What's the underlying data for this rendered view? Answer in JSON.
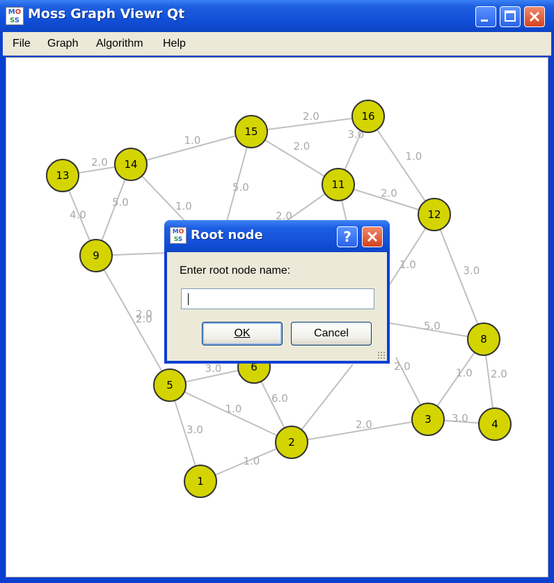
{
  "window": {
    "title": "Moss Graph Viewr Qt",
    "icon": "moss-app-icon"
  },
  "menu": [
    "File",
    "Graph",
    "Algorithm",
    "Help"
  ],
  "graph": {
    "nodes": [
      {
        "id": "1"
      },
      {
        "id": "2"
      },
      {
        "id": "3"
      },
      {
        "id": "4"
      },
      {
        "id": "5"
      },
      {
        "id": "6"
      },
      {
        "id": "8"
      },
      {
        "id": "9"
      },
      {
        "id": "11"
      },
      {
        "id": "12"
      },
      {
        "id": "13"
      },
      {
        "id": "14"
      },
      {
        "id": "15"
      },
      {
        "id": "16"
      }
    ],
    "edges": [
      {
        "from": "13",
        "to": "14",
        "weight": "2.0"
      },
      {
        "from": "14",
        "to": "15",
        "weight": "1.0"
      },
      {
        "from": "15",
        "to": "16",
        "weight": "2.0"
      },
      {
        "from": "15",
        "to": "11",
        "weight": "2.0"
      },
      {
        "from": "16",
        "to": "11",
        "weight": "3.0"
      },
      {
        "from": "16",
        "to": "12",
        "weight": "1.0"
      },
      {
        "from": "11",
        "to": "12",
        "weight": "2.0"
      },
      {
        "from": "13",
        "to": "9",
        "weight": "4.0"
      },
      {
        "from": "14",
        "to": "9",
        "weight": "5.0"
      },
      {
        "from": "9",
        "to": "5",
        "weight": "2.0"
      },
      {
        "from": "12",
        "to": "8",
        "weight": "3.0"
      },
      {
        "from": "8",
        "to": "3",
        "weight": "1.0"
      },
      {
        "from": "8",
        "to": "4",
        "weight": "2.0"
      },
      {
        "from": "3",
        "to": "4",
        "weight": "3.0"
      },
      {
        "from": "2",
        "to": "3",
        "weight": "2.0"
      },
      {
        "from": "5",
        "to": "2",
        "weight": "1.0"
      },
      {
        "from": "5",
        "to": "1",
        "weight": "3.0"
      },
      {
        "from": "1",
        "to": "2",
        "weight": "1.0"
      },
      {
        "from": "6",
        "to": "2",
        "weight": "6.0"
      },
      {
        "from": "5",
        "to": "6",
        "weight": "3.0"
      }
    ],
    "partial_labels": [
      "5.0",
      "1.0",
      "2.0",
      "2.0",
      "1.0",
      "5.0",
      "2.0"
    ]
  },
  "dialog": {
    "title": "Root node",
    "help_button": "?",
    "prompt": "Enter root node name:",
    "input_value": "",
    "ok_label": "OK",
    "cancel_label": "Cancel"
  },
  "colors": {
    "node_fill": "#d4d400",
    "edge": "#c0c0c0",
    "titlebar": "#1250d8"
  }
}
